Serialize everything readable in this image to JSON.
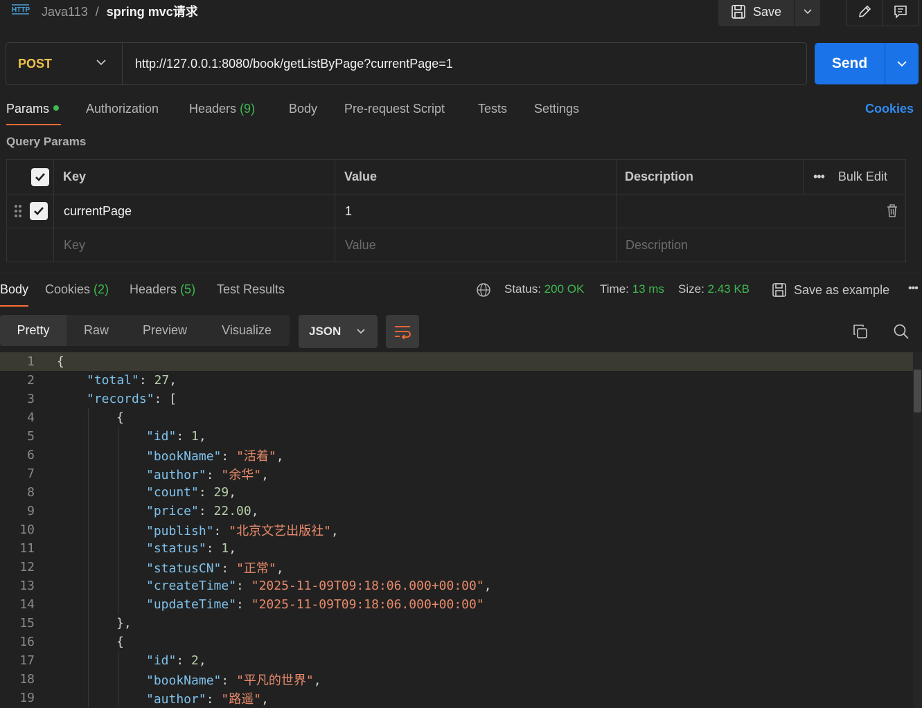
{
  "header": {
    "workspace": "Java113",
    "separator": "/",
    "request_name": "spring mvc请求",
    "save_label": "Save"
  },
  "request": {
    "method": "POST",
    "url": "http://127.0.0.1:8080/book/getListByPage?currentPage=1",
    "send_label": "Send"
  },
  "tabs": [
    {
      "label": "Params"
    },
    {
      "label": "Authorization"
    },
    {
      "label": "Headers",
      "count": "(9)"
    },
    {
      "label": "Body"
    },
    {
      "label": "Pre-request Script"
    },
    {
      "label": "Tests"
    },
    {
      "label": "Settings"
    }
  ],
  "cookies_link": "Cookies",
  "query_params": {
    "title": "Query Params",
    "headers": {
      "key": "Key",
      "value": "Value",
      "description": "Description",
      "bulk_edit": "Bulk Edit"
    },
    "rows": [
      {
        "key": "currentPage",
        "value": "1",
        "checked": true
      }
    ],
    "placeholders": {
      "key": "Key",
      "value": "Value",
      "description": "Description"
    }
  },
  "response": {
    "tabs": [
      {
        "label": "Body"
      },
      {
        "label": "Cookies",
        "count": "(2)"
      },
      {
        "label": "Headers",
        "count": "(5)"
      },
      {
        "label": "Test Results"
      }
    ],
    "status_label": "Status:",
    "status_value": "200 OK",
    "time_label": "Time:",
    "time_value": "13 ms",
    "size_label": "Size:",
    "size_value": "2.43 KB",
    "save_example": "Save as example",
    "view_tabs": [
      "Pretty",
      "Raw",
      "Preview",
      "Visualize"
    ],
    "format": "JSON"
  },
  "code_lines": [
    {
      "n": "1",
      "indent": 0,
      "parts": [
        [
          "p",
          "{"
        ]
      ]
    },
    {
      "n": "2",
      "indent": 1,
      "parts": [
        [
          "k",
          "\"total\""
        ],
        [
          "p",
          ": "
        ],
        [
          "n",
          "27"
        ],
        [
          "p",
          ","
        ]
      ]
    },
    {
      "n": "3",
      "indent": 1,
      "parts": [
        [
          "k",
          "\"records\""
        ],
        [
          "p",
          ": ["
        ]
      ]
    },
    {
      "n": "4",
      "indent": 2,
      "parts": [
        [
          "p",
          "{"
        ]
      ]
    },
    {
      "n": "5",
      "indent": 3,
      "parts": [
        [
          "k",
          "\"id\""
        ],
        [
          "p",
          ": "
        ],
        [
          "n",
          "1"
        ],
        [
          "p",
          ","
        ]
      ]
    },
    {
      "n": "6",
      "indent": 3,
      "parts": [
        [
          "k",
          "\"bookName\""
        ],
        [
          "p",
          ": "
        ],
        [
          "s",
          "\"活着\""
        ],
        [
          "p",
          ","
        ]
      ]
    },
    {
      "n": "7",
      "indent": 3,
      "parts": [
        [
          "k",
          "\"author\""
        ],
        [
          "p",
          ": "
        ],
        [
          "s",
          "\"余华\""
        ],
        [
          "p",
          ","
        ]
      ]
    },
    {
      "n": "8",
      "indent": 3,
      "parts": [
        [
          "k",
          "\"count\""
        ],
        [
          "p",
          ": "
        ],
        [
          "n",
          "29"
        ],
        [
          "p",
          ","
        ]
      ]
    },
    {
      "n": "9",
      "indent": 3,
      "parts": [
        [
          "k",
          "\"price\""
        ],
        [
          "p",
          ": "
        ],
        [
          "n",
          "22.00"
        ],
        [
          "p",
          ","
        ]
      ]
    },
    {
      "n": "10",
      "indent": 3,
      "parts": [
        [
          "k",
          "\"publish\""
        ],
        [
          "p",
          ": "
        ],
        [
          "s",
          "\"北京文艺出版社\""
        ],
        [
          "p",
          ","
        ]
      ]
    },
    {
      "n": "11",
      "indent": 3,
      "parts": [
        [
          "k",
          "\"status\""
        ],
        [
          "p",
          ": "
        ],
        [
          "n",
          "1"
        ],
        [
          "p",
          ","
        ]
      ]
    },
    {
      "n": "12",
      "indent": 3,
      "parts": [
        [
          "k",
          "\"statusCN\""
        ],
        [
          "p",
          ": "
        ],
        [
          "s",
          "\"正常\""
        ],
        [
          "p",
          ","
        ]
      ]
    },
    {
      "n": "13",
      "indent": 3,
      "parts": [
        [
          "k",
          "\"createTime\""
        ],
        [
          "p",
          ": "
        ],
        [
          "s",
          "\"2025-11-09T09:18:06.000+00:00\""
        ],
        [
          "p",
          ","
        ]
      ]
    },
    {
      "n": "14",
      "indent": 3,
      "parts": [
        [
          "k",
          "\"updateTime\""
        ],
        [
          "p",
          ": "
        ],
        [
          "s",
          "\"2025-11-09T09:18:06.000+00:00\""
        ]
      ]
    },
    {
      "n": "15",
      "indent": 2,
      "parts": [
        [
          "p",
          "},"
        ]
      ]
    },
    {
      "n": "16",
      "indent": 2,
      "parts": [
        [
          "p",
          "{"
        ]
      ]
    },
    {
      "n": "17",
      "indent": 3,
      "parts": [
        [
          "k",
          "\"id\""
        ],
        [
          "p",
          ": "
        ],
        [
          "n",
          "2"
        ],
        [
          "p",
          ","
        ]
      ]
    },
    {
      "n": "18",
      "indent": 3,
      "parts": [
        [
          "k",
          "\"bookName\""
        ],
        [
          "p",
          ": "
        ],
        [
          "s",
          "\"平凡的世界\""
        ],
        [
          "p",
          ","
        ]
      ]
    },
    {
      "n": "19",
      "indent": 3,
      "parts": [
        [
          "k",
          "\"author\""
        ],
        [
          "p",
          ": "
        ],
        [
          "s",
          "\"路遥\""
        ],
        [
          "p",
          ","
        ]
      ]
    }
  ]
}
